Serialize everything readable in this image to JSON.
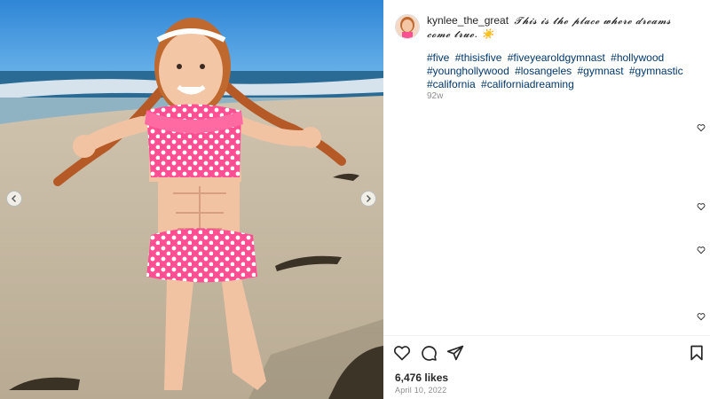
{
  "post": {
    "username": "kynlee_the_great",
    "caption": "𝓣𝓱𝓲𝓼 𝓲𝓼 𝓽𝓱𝓮 𝓹𝓵𝓪𝓬𝓮 𝔀𝓱𝓮𝓻𝓮 𝓭𝓻𝓮𝓪𝓶𝓼 𝓬𝓸𝓶𝓮 𝓽𝓻𝓾𝓮. ☀️",
    "hashtags": [
      "#five",
      "#thisisfive",
      "#fiveyearoldgymnast",
      "#hollywood",
      "#younghollywood",
      "#losangeles",
      "#gymnast",
      "#gymnastic",
      "#california",
      "#californiadreaming"
    ],
    "age": "92w",
    "likes": "6,476 likes",
    "date": "April 10, 2022"
  },
  "icons": {
    "prev": "chevron-left-icon",
    "next": "chevron-right-icon",
    "like": "heart-icon",
    "comment": "comment-icon",
    "share": "paper-plane-icon",
    "save": "bookmark-icon"
  },
  "colors": {
    "hashtag": "#00376b",
    "muted": "#8e8e8e",
    "text": "#262626"
  }
}
